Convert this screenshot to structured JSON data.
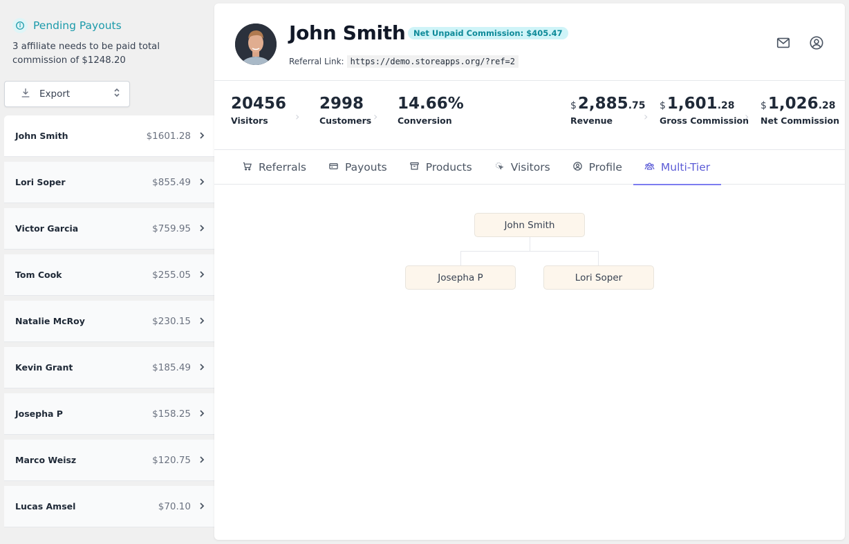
{
  "sidebar": {
    "pending": {
      "title": "Pending Payouts",
      "description": "3 affiliate needs to be paid total commission of $1248.20"
    },
    "export_label": "Export",
    "affiliates": [
      {
        "name": "John Smith",
        "amount": "$1601.28",
        "active": true
      },
      {
        "name": "Lori Soper",
        "amount": "$855.49"
      },
      {
        "name": "Victor Garcia",
        "amount": "$759.95"
      },
      {
        "name": "Tom Cook",
        "amount": "$255.05"
      },
      {
        "name": "Natalie McRoy",
        "amount": "$230.15"
      },
      {
        "name": "Kevin Grant",
        "amount": "$185.49"
      },
      {
        "name": "Josepha P",
        "amount": "$158.25"
      },
      {
        "name": "Marco Weisz",
        "amount": "$120.75"
      },
      {
        "name": "Lucas Amsel",
        "amount": "$70.10"
      }
    ]
  },
  "header": {
    "name": "John Smith",
    "badge": "Net Unpaid Commission: $405.47",
    "referral_label": "Referral Link:",
    "referral_url": "https://demo.storeapps.org/?ref=2",
    "icons": [
      "mail-icon",
      "user-circle-icon"
    ]
  },
  "stats": {
    "visitors": {
      "value": "20456",
      "label": "Visitors"
    },
    "customers": {
      "value": "2998",
      "label": "Customers"
    },
    "conversion": {
      "value": "14.66%",
      "label": "Conversion"
    },
    "revenue": {
      "currency": "$",
      "whole": "2,885",
      "decimal": ".75",
      "label": "Revenue"
    },
    "gross": {
      "currency": "$",
      "whole": "1,601",
      "decimal": ".28",
      "label": "Gross Commission"
    },
    "net": {
      "currency": "$",
      "whole": "1,026",
      "decimal": ".28",
      "label": "Net Commission"
    }
  },
  "tabs": [
    {
      "label": "Referrals",
      "icon": "cart-icon"
    },
    {
      "label": "Payouts",
      "icon": "card-icon"
    },
    {
      "label": "Products",
      "icon": "archive-icon"
    },
    {
      "label": "Visitors",
      "icon": "cursor-click-icon"
    },
    {
      "label": "Profile",
      "icon": "user-circle-icon"
    },
    {
      "label": "Multi-Tier",
      "icon": "users-group-icon",
      "active": true
    }
  ],
  "tree": {
    "root": "John Smith",
    "children": [
      "Josepha P",
      "Lori Soper"
    ]
  },
  "colors": {
    "accent": "#5b5bd6",
    "teal": "#1b9aaa",
    "node_bg": "#fdf6ec"
  }
}
